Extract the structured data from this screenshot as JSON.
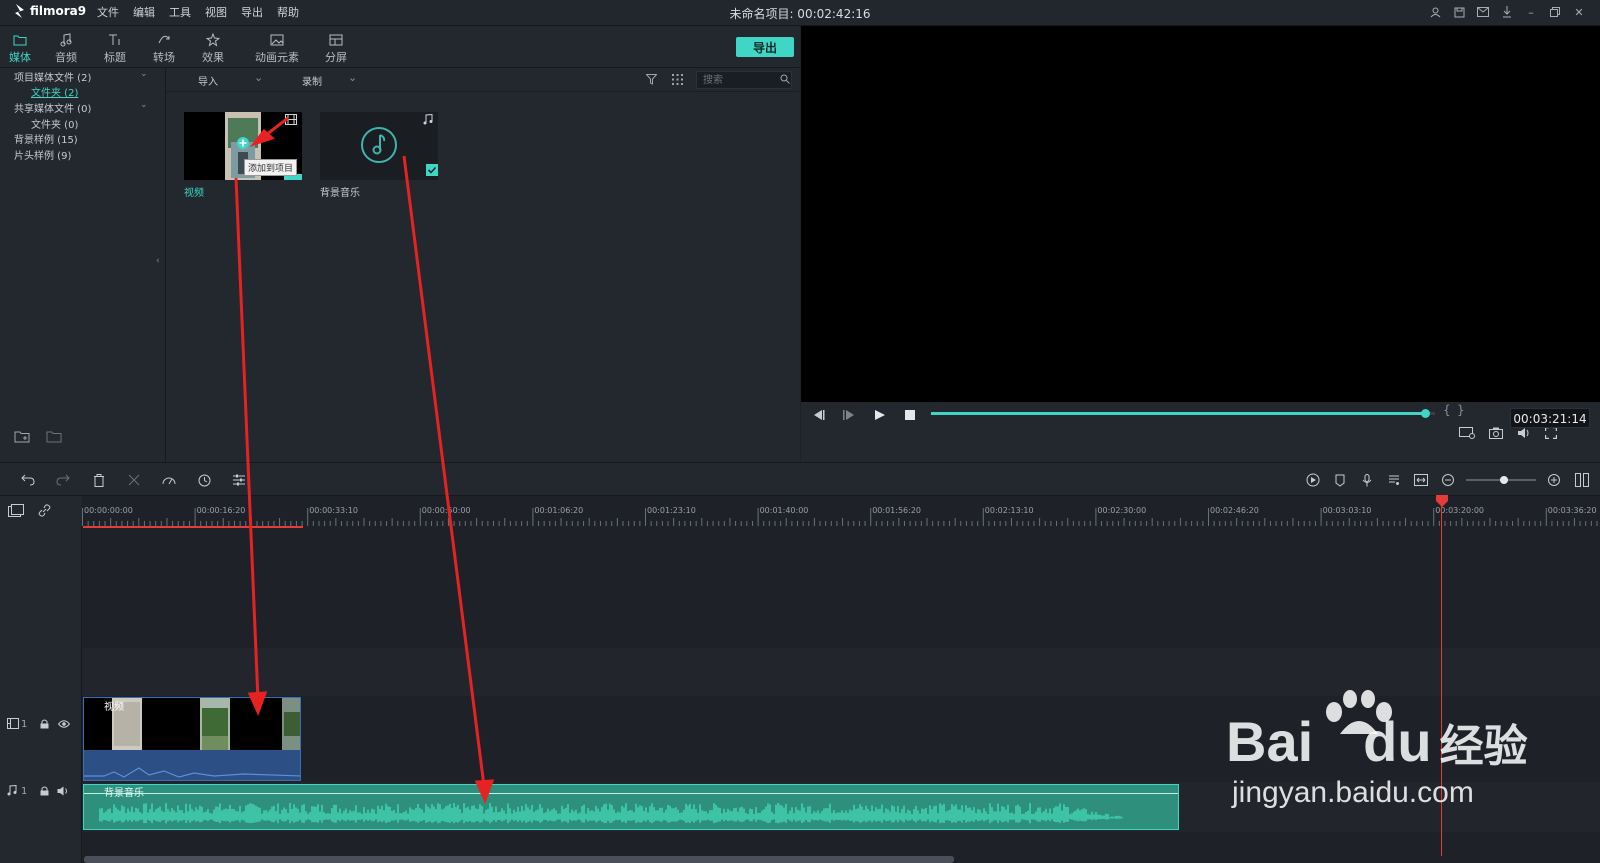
{
  "app": {
    "name": "filmora9",
    "project_title": "未命名项目: 00:02:42:16"
  },
  "menu": [
    "文件",
    "编辑",
    "工具",
    "视图",
    "导出",
    "帮助"
  ],
  "tabs": [
    {
      "label": "媒体",
      "icon": "folder-icon"
    },
    {
      "label": "音频",
      "icon": "music-note-icon"
    },
    {
      "label": "标题",
      "icon": "title-text-icon"
    },
    {
      "label": "转场",
      "icon": "transition-icon"
    },
    {
      "label": "效果",
      "icon": "effects-icon"
    },
    {
      "label": "动画元素",
      "icon": "image-element-icon"
    },
    {
      "label": "分屏",
      "icon": "split-screen-icon"
    }
  ],
  "export_label": "导出",
  "tree": {
    "project_media": "项目媒体文件 (2)",
    "project_folder": "文件夹 (2)",
    "shared_media": "共享媒体文件 (0)",
    "shared_folder": "文件夹 (0)",
    "bg_samples": "背景样例 (15)",
    "intro_samples": "片头样例 (9)"
  },
  "media_bar": {
    "import": "导入",
    "record": "录制",
    "search_placeholder": "搜索"
  },
  "media": {
    "video_label": "视频",
    "music_label": "背景音乐",
    "add_tooltip": "添加到项目"
  },
  "preview": {
    "timecode": "00:03:21:14",
    "progress": 0.98
  },
  "ruler": {
    "ticks": [
      "00:00:00:00",
      "00:00:16:20",
      "00:00:33:10",
      "00:00:50:00",
      "00:01:06:20",
      "00:01:23:10",
      "00:01:40:00",
      "00:01:56:20",
      "00:02:13:10",
      "00:02:30:00",
      "00:02:46:20",
      "00:03:03:10",
      "00:03:20:00",
      "00:03:36:20"
    ]
  },
  "tracks": {
    "video_index": "1",
    "audio_index": "1",
    "video_clip_label": "视频",
    "audio_clip_label": "背景音乐"
  },
  "colors": {
    "accent": "#3fd6c6",
    "playhead": "#e63b3b",
    "annotation": "#e62222"
  },
  "watermark": {
    "brand": "Bai",
    "brand2": "du",
    "cn": "经验",
    "url": "jingyan.baidu.com"
  }
}
